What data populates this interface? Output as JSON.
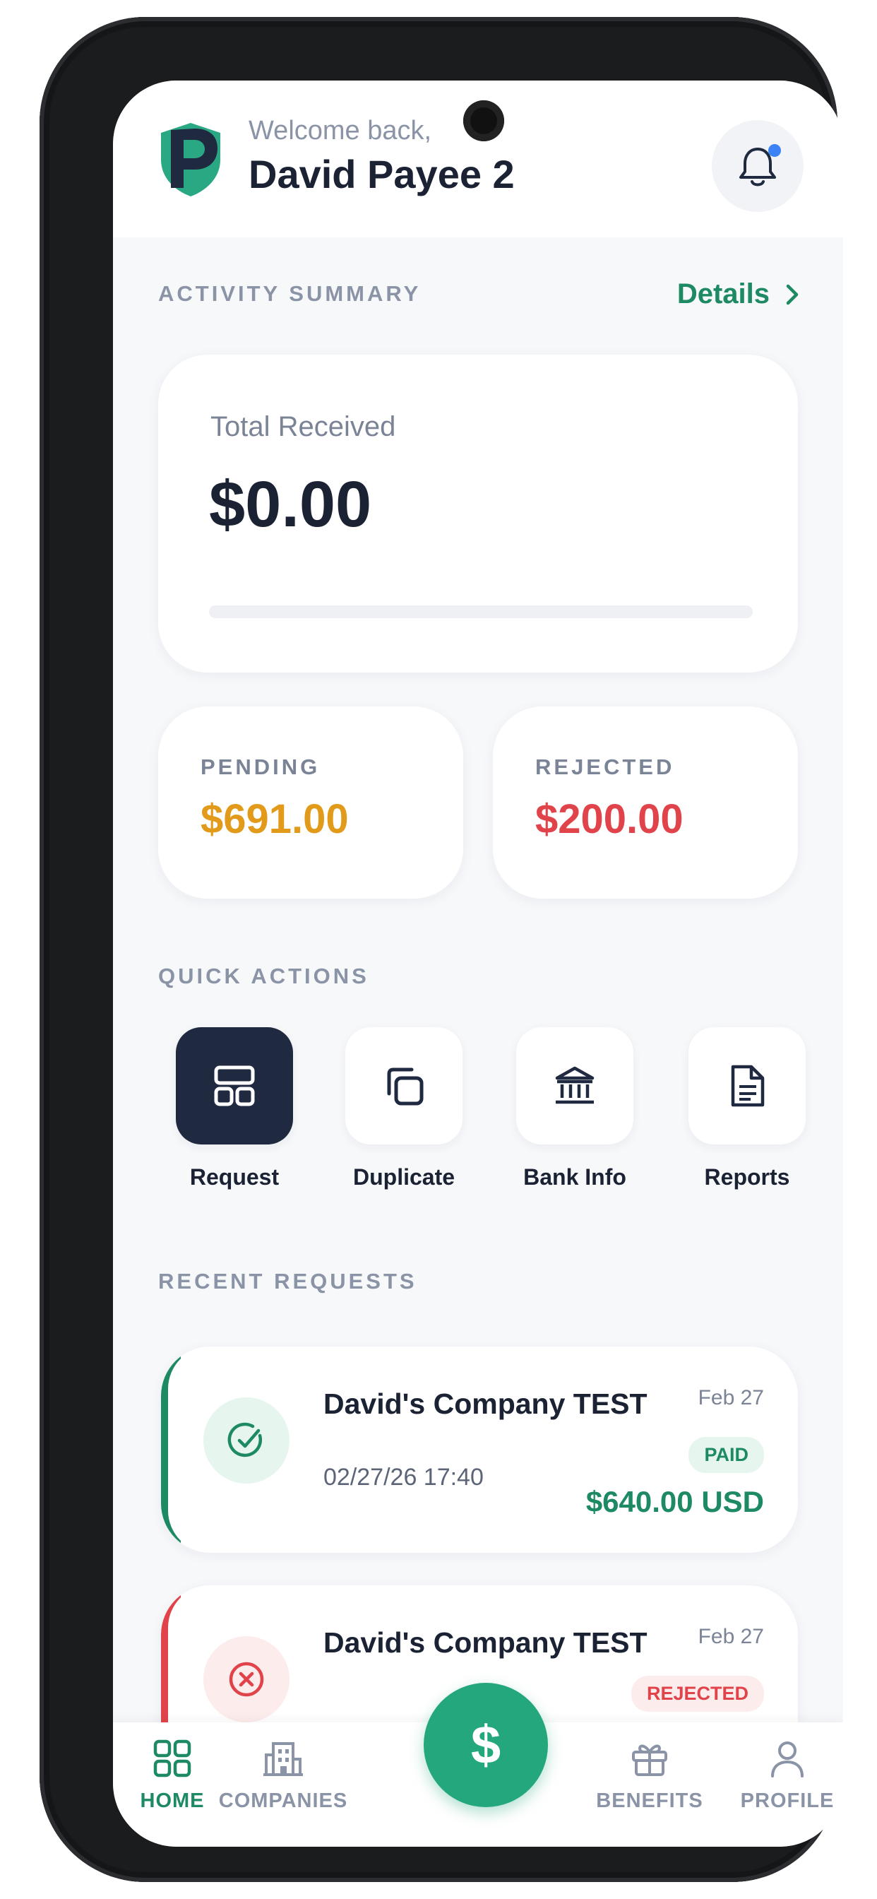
{
  "header": {
    "welcome_text": "Welcome back,",
    "user_name": "David Payee 2"
  },
  "activity": {
    "section_title": "ACTIVITY SUMMARY",
    "details_label": "Details",
    "total_label": "Total Received",
    "total_amount": "$0.00",
    "total_progress_fraction": 0,
    "pending_label": "PENDING",
    "pending_amount": "$691.00",
    "rejected_label": "REJECTED",
    "rejected_amount": "$200.00"
  },
  "quick_actions": {
    "section_title": "QUICK ACTIONS",
    "items": [
      {
        "label": "Request",
        "icon": "layout-grid-icon"
      },
      {
        "label": "Duplicate",
        "icon": "copy-icon"
      },
      {
        "label": "Bank Info",
        "icon": "bank-icon"
      },
      {
        "label": "Reports",
        "icon": "document-icon"
      }
    ]
  },
  "recent_requests": {
    "section_title": "RECENT REQUESTS",
    "items": [
      {
        "company": "David's Company TEST",
        "date": "Feb 27",
        "timestamp": "02/27/26 17:40",
        "status": "PAID",
        "amount": "$640.00 USD"
      },
      {
        "company": "David's Company TEST",
        "date": "Feb 27",
        "status": "REJECTED"
      }
    ]
  },
  "bottom_nav": {
    "items": [
      {
        "label": "HOME",
        "icon": "home-grid-icon",
        "active": true
      },
      {
        "label": "COMPANIES",
        "icon": "building-icon",
        "active": false
      },
      {
        "label": "BENEFITS",
        "icon": "gift-icon",
        "active": false
      },
      {
        "label": "PROFILE",
        "icon": "user-icon",
        "active": false
      }
    ],
    "center_button_glyph": "$"
  },
  "colors": {
    "accent_green": "#1e8a63",
    "pending_orange": "#e29a1a",
    "rejected_red": "#e0444a",
    "dark_navy": "#1f2940"
  }
}
